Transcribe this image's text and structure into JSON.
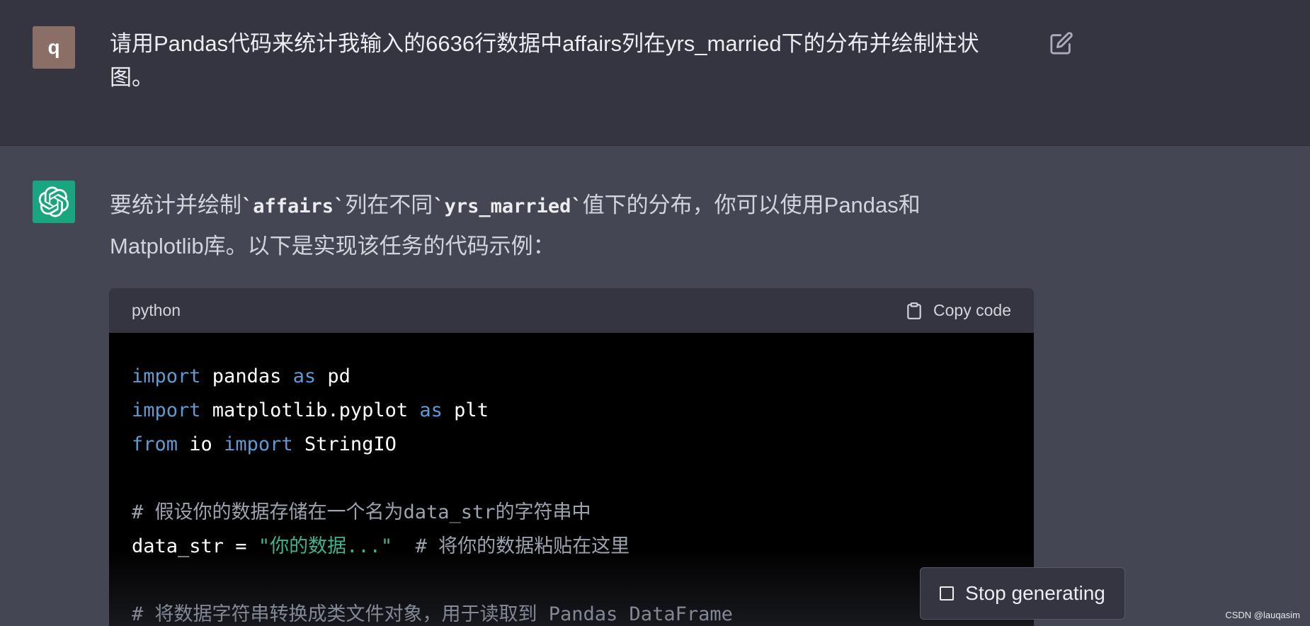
{
  "user_message": {
    "avatar_letter": "q",
    "text": "请用Pandas代码来统计我输入的6636行数据中affairs列在yrs_married下的分布并绘制柱状图。",
    "edit_icon": "edit-icon"
  },
  "assistant_message": {
    "intro_part1": "要统计并绘制",
    "code_affairs": "`affairs`",
    "intro_part2": "列在不同",
    "code_yrs": "`yrs_married`",
    "intro_part3": "值下的分布，你可以使用Pandas和Matplotlib库。以下是实现该任务的代码示例：",
    "code_block": {
      "language": "python",
      "copy_label": "Copy code",
      "lines": {
        "l1": {
          "kw1": "import",
          "t1": " pandas ",
          "kw2": "as",
          "t2": " pd"
        },
        "l2": {
          "kw1": "import",
          "t1": " matplotlib.pyplot ",
          "kw2": "as",
          "t2": " plt"
        },
        "l3": {
          "kw1": "from",
          "t1": " io ",
          "kw2": "import",
          "t2": " StringIO"
        },
        "l5": {
          "comment": "# 假设你的数据存储在一个名为data_str的字符串中"
        },
        "l6": {
          "t1": "data_str = ",
          "str": "\"你的数据...\"",
          "comment": "  # 将你的数据粘贴在这里"
        },
        "l8": {
          "comment": "# 将数据字符串转换成类文件对象，用于读取到 Pandas DataFrame"
        }
      }
    }
  },
  "stop_button": {
    "label": "Stop generating"
  },
  "watermark": "CSDN @lauqasim"
}
